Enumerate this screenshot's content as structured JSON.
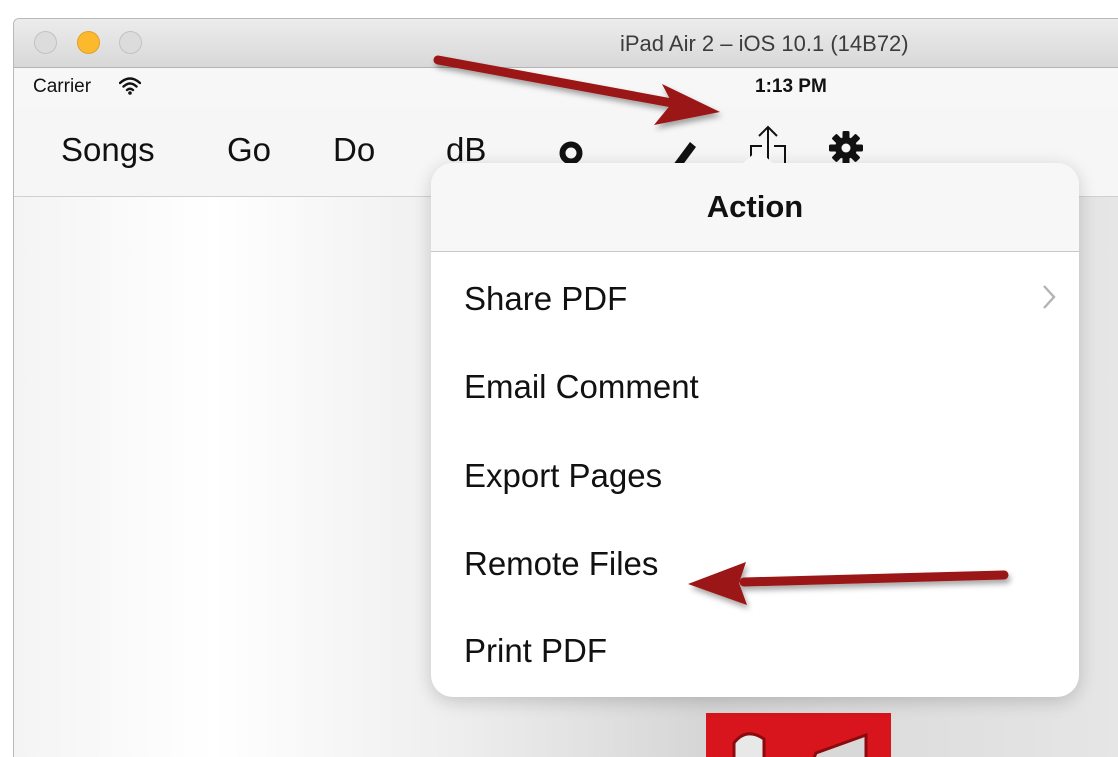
{
  "window": {
    "title": "iPad Air 2 – iOS 10.1 (14B72)",
    "traffic_lights": [
      "close",
      "minimize",
      "zoom"
    ]
  },
  "statusbar": {
    "carrier": "Carrier",
    "time": "1:13 PM",
    "icons": [
      "wifi-icon"
    ]
  },
  "toolbar": {
    "songs": "Songs",
    "go": "Go",
    "do": "Do",
    "db": "dB",
    "icons": [
      "record-icon",
      "pencil-icon",
      "share-icon",
      "gear-icon"
    ]
  },
  "popover": {
    "title": "Action",
    "items": [
      {
        "label": "Share PDF",
        "has_chevron": true
      },
      {
        "label": "Email Comment"
      },
      {
        "label": "Export Pages"
      },
      {
        "label": "Remote Files"
      },
      {
        "label": "Print PDF"
      }
    ]
  },
  "colors": {
    "annotation_arrow": "#9b1212",
    "minimize_light": "#fdb92e",
    "graphic_red": "#d8141c"
  }
}
